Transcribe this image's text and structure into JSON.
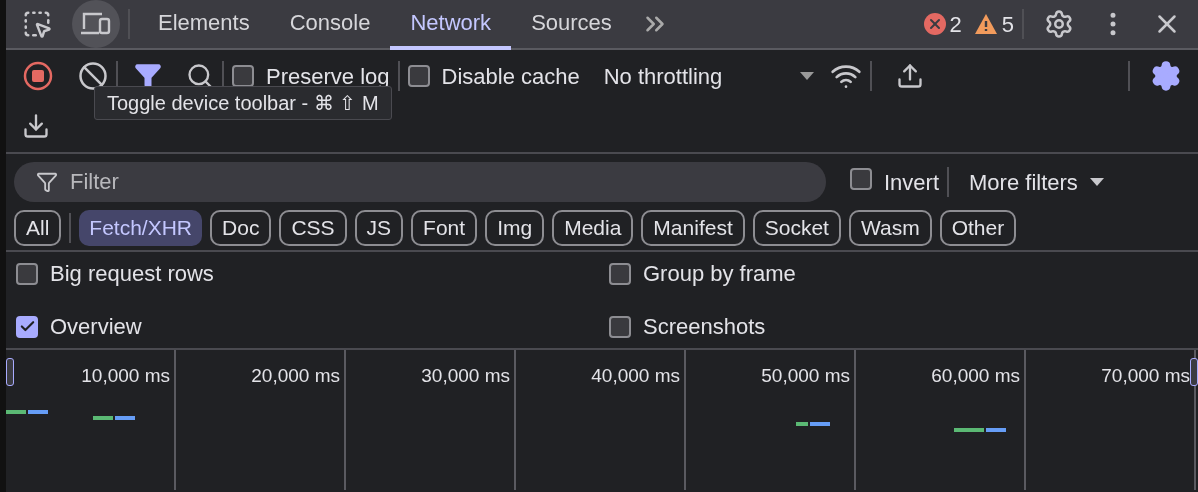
{
  "tabs": [
    {
      "label": "Elements",
      "selected": false
    },
    {
      "label": "Console",
      "selected": false
    },
    {
      "label": "Network",
      "selected": true
    },
    {
      "label": "Sources",
      "selected": false
    }
  ],
  "issues": {
    "errors": "2",
    "warnings": "5"
  },
  "toolbar": {
    "recording": true,
    "preserve_log": {
      "label": "Preserve log",
      "checked": false
    },
    "disable_cache": {
      "label": "Disable cache",
      "checked": false
    },
    "throttling": "No throttling"
  },
  "tooltip": "Toggle device toolbar - ⌘ ⇧ M",
  "filter": {
    "placeholder": "Filter",
    "invert": {
      "label": "Invert",
      "checked": false
    },
    "more_filters": "More filters"
  },
  "type_filters": [
    {
      "label": "All",
      "selected": false
    },
    {
      "label": "Fetch/XHR",
      "selected": true
    },
    {
      "label": "Doc",
      "selected": false
    },
    {
      "label": "CSS",
      "selected": false
    },
    {
      "label": "JS",
      "selected": false
    },
    {
      "label": "Font",
      "selected": false
    },
    {
      "label": "Img",
      "selected": false
    },
    {
      "label": "Media",
      "selected": false
    },
    {
      "label": "Manifest",
      "selected": false
    },
    {
      "label": "Socket",
      "selected": false
    },
    {
      "label": "Wasm",
      "selected": false
    },
    {
      "label": "Other",
      "selected": false
    }
  ],
  "options": [
    {
      "label": "Big request rows",
      "checked": false
    },
    {
      "label": "Group by frame",
      "checked": false
    },
    {
      "label": "Overview",
      "checked": true
    },
    {
      "label": "Screenshots",
      "checked": false
    }
  ],
  "overview_ticks": [
    "10,000 ms",
    "20,000 ms",
    "30,000 ms",
    "40,000 ms",
    "50,000 ms",
    "60,000 ms",
    "70,000 ms"
  ]
}
